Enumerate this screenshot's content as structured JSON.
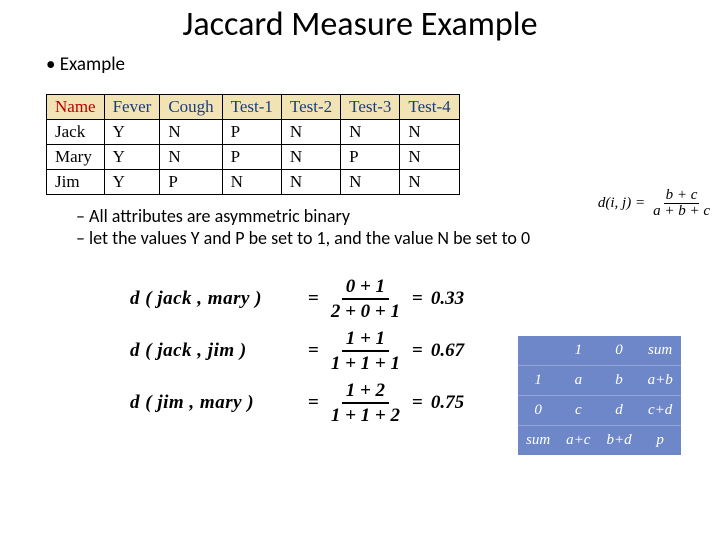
{
  "title": "Jaccard Measure Example",
  "bullet1": "Example",
  "table": {
    "headers": [
      "Name",
      "Fever",
      "Cough",
      "Test-1",
      "Test-2",
      "Test-3",
      "Test-4"
    ],
    "rows": [
      [
        "Jack",
        "Y",
        "N",
        "P",
        "N",
        "N",
        "N"
      ],
      [
        "Mary",
        "Y",
        "N",
        "P",
        "N",
        "P",
        "N"
      ],
      [
        "Jim",
        "Y",
        "P",
        "N",
        "N",
        "N",
        "N"
      ]
    ]
  },
  "formula": {
    "lhs": "d(i, j) =",
    "num": "b + c",
    "den": "a + b + c"
  },
  "sub_bullets": [
    "All attributes are asymmetric binary",
    "let the values Y and P be set to 1, and the value N be set to 0"
  ],
  "equations": [
    {
      "lhs": "d ( jack , mary )",
      "num": "0 + 1",
      "den": "2 + 0 + 1",
      "rhs": "0.33"
    },
    {
      "lhs": "d ( jack , jim )",
      "num": "1 + 1",
      "den": "1 + 1 + 1",
      "rhs": "0.67"
    },
    {
      "lhs": "d ( jim , mary )",
      "num": "1 + 2",
      "den": "1 + 1 + 2",
      "rhs": "0.75"
    }
  ],
  "confusion": {
    "r0": [
      "",
      "1",
      "0",
      "sum"
    ],
    "r1": [
      "1",
      "a",
      "b",
      "a+b"
    ],
    "r2": [
      "0",
      "c",
      "d",
      "c+d"
    ],
    "r3": [
      "sum",
      "a+c",
      "b+d",
      "p"
    ]
  }
}
